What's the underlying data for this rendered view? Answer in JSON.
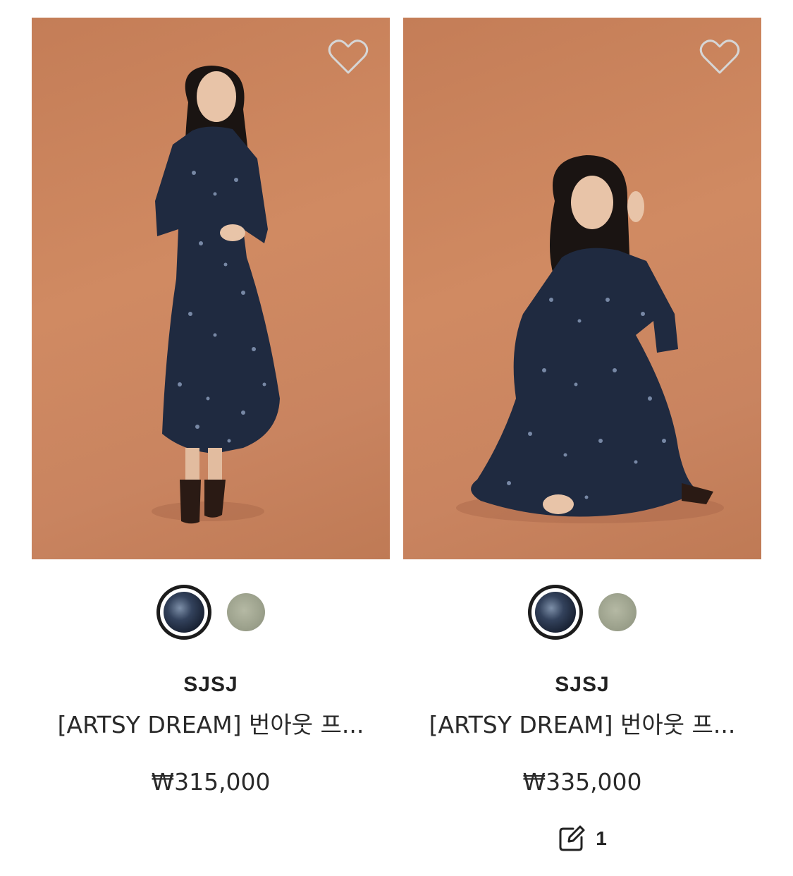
{
  "products": [
    {
      "brand": "SJSJ",
      "name": "[ARTSY DREAM] 번아웃 프...",
      "price": "₩315,000",
      "colors": [
        "navy",
        "sage"
      ],
      "selected_color": "navy",
      "favorite": false,
      "image": "model standing in floral midi dress"
    },
    {
      "brand": "SJSJ",
      "name": "[ARTSY DREAM] 번아웃 프...",
      "price": "₩335,000",
      "colors": [
        "navy",
        "sage"
      ],
      "selected_color": "navy",
      "favorite": false,
      "image": "model kneeling in floral midi dress",
      "review_count": "1"
    }
  ],
  "colors": {
    "photo_background": "#c98460",
    "dress": "#1f2a40",
    "heart_outline": "#d9d9d9"
  }
}
